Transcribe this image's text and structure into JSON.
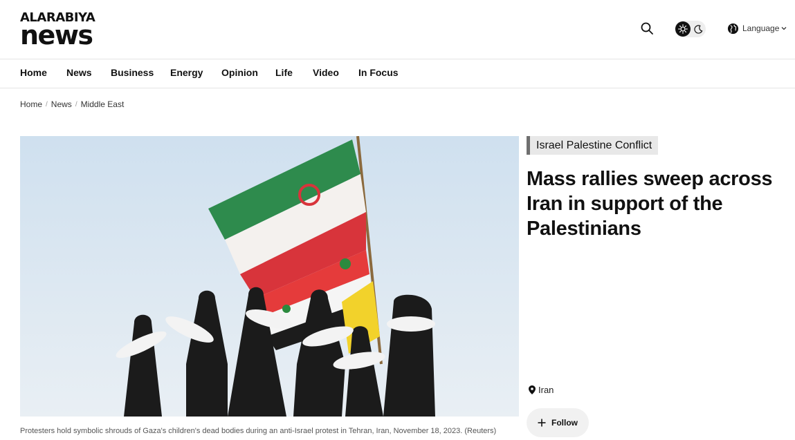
{
  "brand": {
    "top": "ALARABIYA",
    "bottom": "news"
  },
  "header": {
    "language_label": "Language"
  },
  "nav": [
    {
      "label": "Home"
    },
    {
      "label": "News"
    },
    {
      "label": "Business"
    },
    {
      "label": "Energy"
    },
    {
      "label": "Opinion"
    },
    {
      "label": "Life"
    },
    {
      "label": "Video"
    },
    {
      "label": "In Focus"
    }
  ],
  "breadcrumb": [
    {
      "label": "Home"
    },
    {
      "label": "News"
    },
    {
      "label": "Middle East"
    }
  ],
  "article": {
    "tag": "Israel Palestine Conflict",
    "title": "Mass rallies sweep across Iran in support of the Palestinians",
    "location": "Iran",
    "follow_label": "Follow",
    "caption": "Protesters hold symbolic shrouds of Gaza's children's dead bodies during an anti-Israel protest in Tehran, Iran, November 18, 2023. (Reuters)"
  },
  "icons": {
    "search": "search-icon",
    "theme_light": "sun-icon",
    "theme_dark": "moon-icon",
    "language": "globe-icon",
    "language_chevron": "chevron-down-icon",
    "location": "map-pin-icon",
    "follow": "plus-icon"
  },
  "colors": {
    "tag_background": "#e8e8e8",
    "tag_accent": "#6f6f6f",
    "toggle_background": "#eeeeee",
    "follow_background": "#f1f1f1"
  }
}
